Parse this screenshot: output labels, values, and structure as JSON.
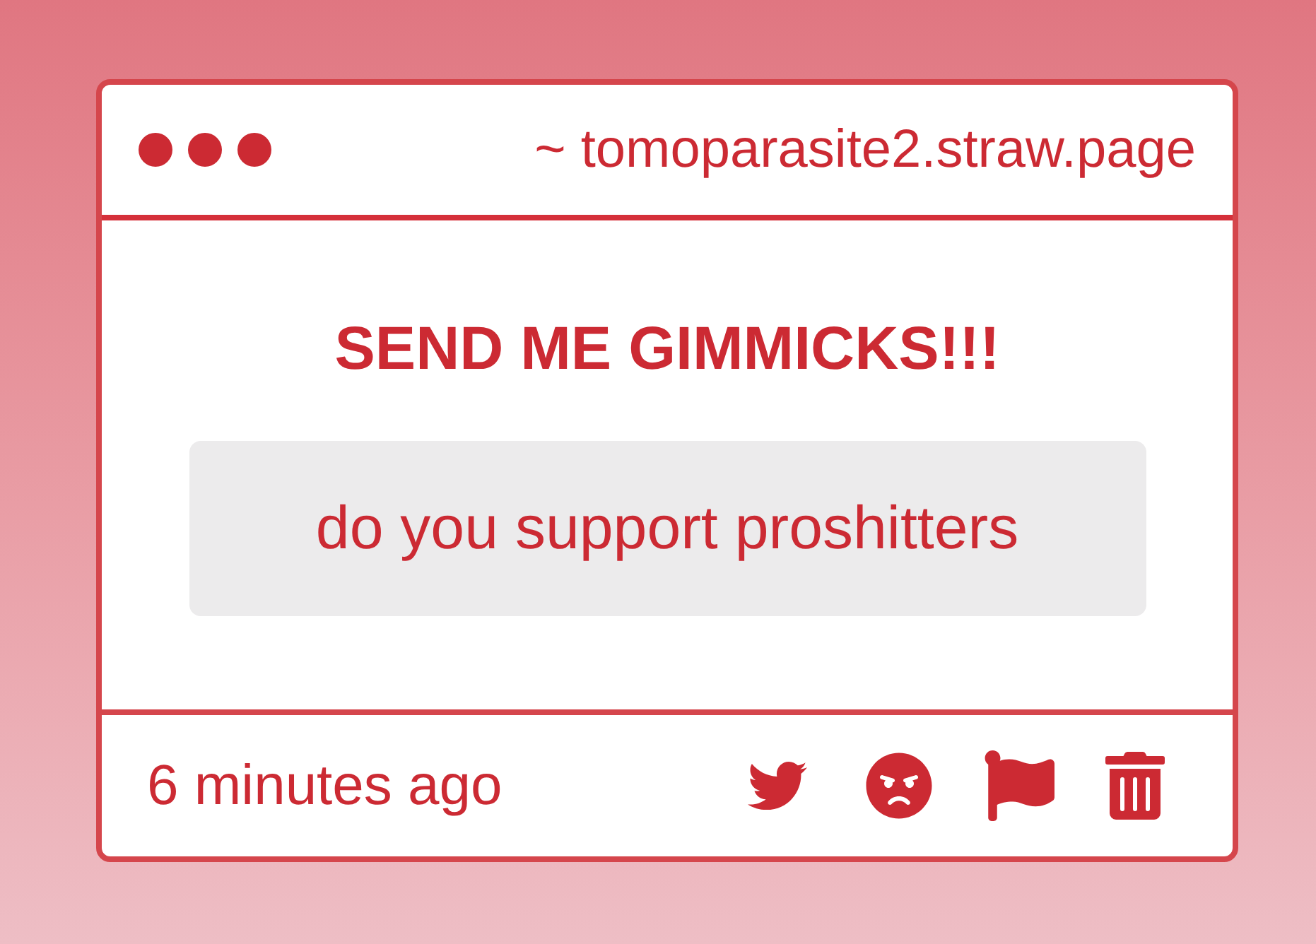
{
  "window": {
    "url": "~ tomoparasite2.straw.page"
  },
  "title": "SEND ME GIMMICKS!!!",
  "question": "do you support proshitters",
  "footer": {
    "time": "6 minutes ago",
    "actions": [
      {
        "kind": "twitter"
      },
      {
        "kind": "angry"
      },
      {
        "kind": "flag"
      },
      {
        "kind": "trash"
      }
    ]
  }
}
